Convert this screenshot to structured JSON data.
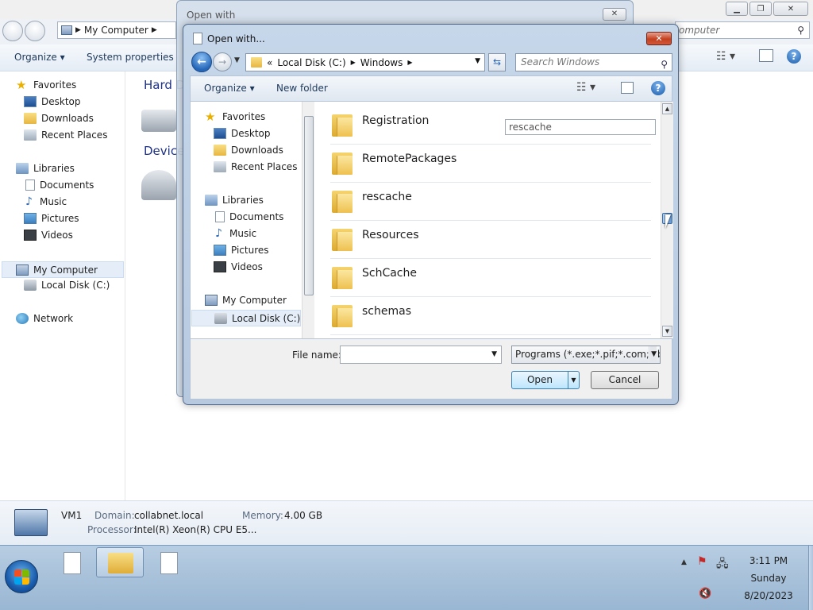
{
  "explorer": {
    "address": "My Computer",
    "search_placeholder": "Search My Computer",
    "search_visible": "omputer",
    "toolbar": {
      "organize": "Organize",
      "system_properties": "System properties"
    },
    "sidebar": {
      "favorites": "Favorites",
      "desktop": "Desktop",
      "downloads": "Downloads",
      "recent_places": "Recent Places",
      "libraries": "Libraries",
      "documents": "Documents",
      "music": "Music",
      "pictures": "Pictures",
      "videos": "Videos",
      "my_computer": "My Computer",
      "local_disk": "Local Disk (C:)",
      "network": "Network"
    },
    "main": {
      "hard_disk_heading": "Hard D",
      "devices_heading": "Device"
    },
    "details": {
      "computer_name": "VM1",
      "domain_label": "Domain:",
      "domain_value": "collabnet.local",
      "memory_label": "Memory:",
      "memory_value": "4.00 GB",
      "processor_label": "Processor:",
      "processor_value": "Intel(R) Xeon(R) CPU E5..."
    }
  },
  "open_with_window": {
    "title": "Open with",
    "close_symbol": "✕"
  },
  "dialog": {
    "title": "Open with...",
    "close_symbol": "✕",
    "breadcrumb": {
      "overflow": "«",
      "part1": "Local Disk (C:)",
      "part2": "Windows"
    },
    "search_placeholder": "Search Windows",
    "toolbar": {
      "organize": "Organize",
      "new_folder": "New folder"
    },
    "sidebar": {
      "favorites": "Favorites",
      "desktop": "Desktop",
      "downloads": "Downloads",
      "recent_places": "Recent Places",
      "libraries": "Libraries",
      "documents": "Documents",
      "music": "Music",
      "pictures": "Pictures",
      "videos": "Videos",
      "my_computer": "My Computer",
      "local_disk": "Local Disk (C:)"
    },
    "files": [
      {
        "name": "Registration"
      },
      {
        "name": "RemotePackages"
      },
      {
        "name": "rescache"
      },
      {
        "name": "Resources"
      },
      {
        "name": "SchCache"
      },
      {
        "name": "schemas"
      }
    ],
    "rename_value": "rescache",
    "file_name_label": "File name:",
    "file_name_value": "",
    "file_type": "Programs (*.exe;*.pif;*.com;*.bat;*.cmd)",
    "open_label": "Open",
    "cancel_label": "Cancel"
  },
  "taskbar": {
    "time": "3:11 PM",
    "day": "Sunday",
    "date": "8/20/2023"
  }
}
